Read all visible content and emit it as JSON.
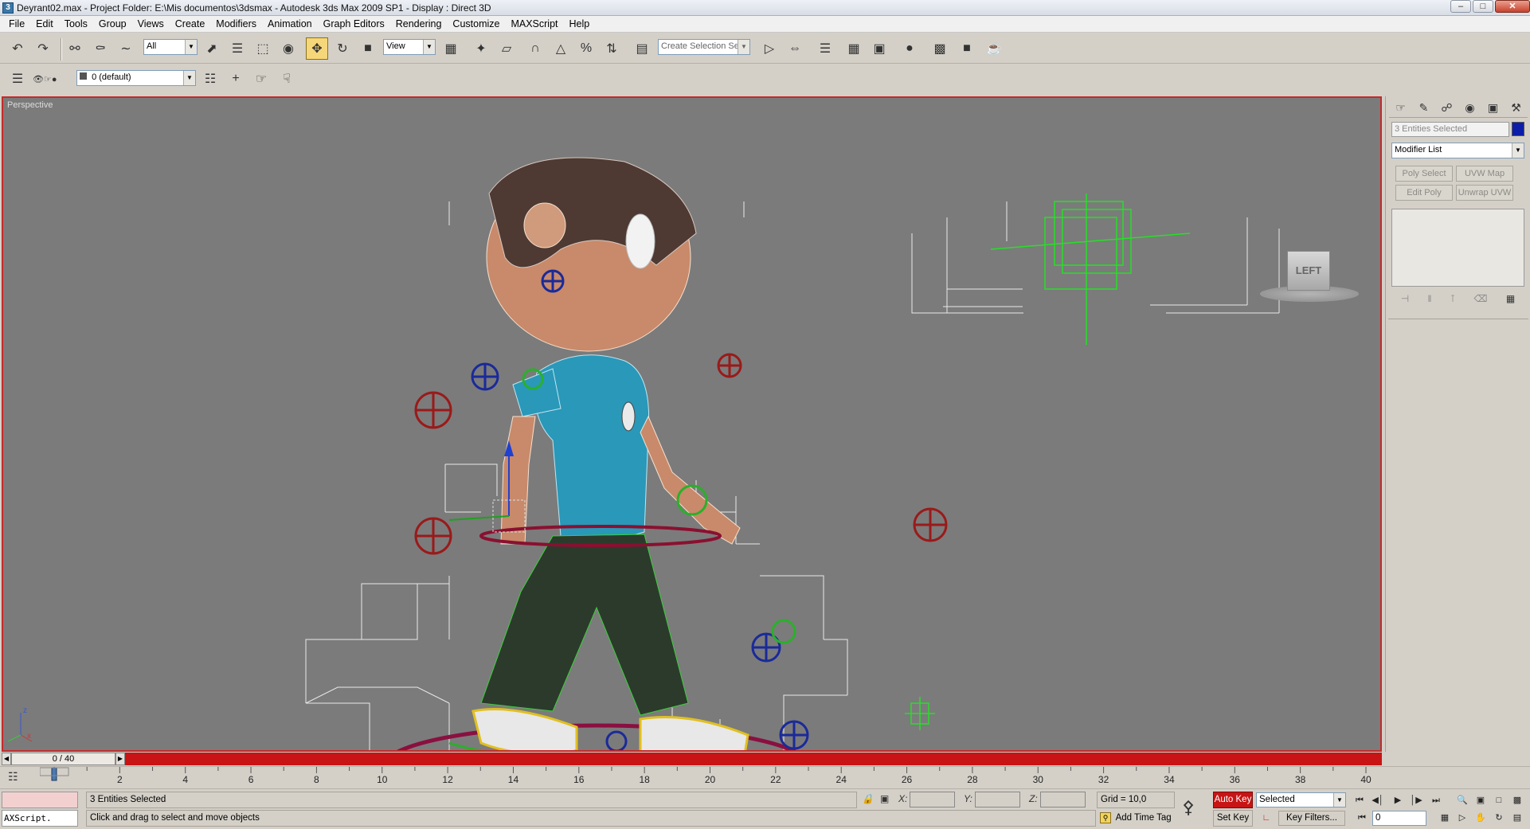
{
  "title": {
    "app_icon": "3",
    "text": "Deyrant02.max     - Project Folder: E:\\Mis documentos\\3dsmax      - Autodesk 3ds Max  2009 SP1      - Display : Direct 3D",
    "minimize": "–",
    "maximize": "□",
    "close": "✕"
  },
  "menu": [
    "File",
    "Edit",
    "Tools",
    "Group",
    "Views",
    "Create",
    "Modifiers",
    "Animation",
    "Graph Editors",
    "Rendering",
    "Customize",
    "MAXScript",
    "Help"
  ],
  "toolbar": {
    "selection_filter": "All",
    "reference_coord": "View",
    "named_selection": "Create Selection Set"
  },
  "layer_toolbar": {
    "current_layer": "0 (default)"
  },
  "viewport": {
    "label": "Perspective",
    "view_cube_label": "LEFT",
    "axis_z": "z",
    "axis_x": "x"
  },
  "command_panel": {
    "selection_name": "3 Entities Selected",
    "object_color": "#0c1ea8",
    "modifier_list": "Modifier List",
    "buttons": [
      "Poly Select",
      "UVW Map",
      "Edit Poly",
      "Unwrap UVW"
    ]
  },
  "timeline": {
    "frame_readout": "0 / 40",
    "current_frame": 0,
    "total_frames": 40,
    "ticks": [
      "2",
      "4",
      "6",
      "8",
      "10",
      "12",
      "14",
      "16",
      "18",
      "20",
      "22",
      "24",
      "26",
      "28",
      "30",
      "32",
      "34",
      "36",
      "38",
      "40"
    ]
  },
  "status": {
    "maxscript_label": "AXScript.",
    "selection_info": "3 Entities Selected",
    "prompt": "Click and drag to select and move objects",
    "x_label": "X:",
    "y_label": "Y:",
    "z_label": "Z:",
    "grid": "Grid = 10,0",
    "add_time_tag": "Add Time Tag",
    "auto_key": "Auto Key",
    "set_key": "Set Key",
    "key_mode": "Selected",
    "key_filters": "Key Filters...",
    "frame_spinner": "0"
  },
  "colors": {
    "active_viewport_border": "#c62a2a",
    "auto_key_active": "#c81414",
    "viewport_background": "#7b7b7b"
  }
}
